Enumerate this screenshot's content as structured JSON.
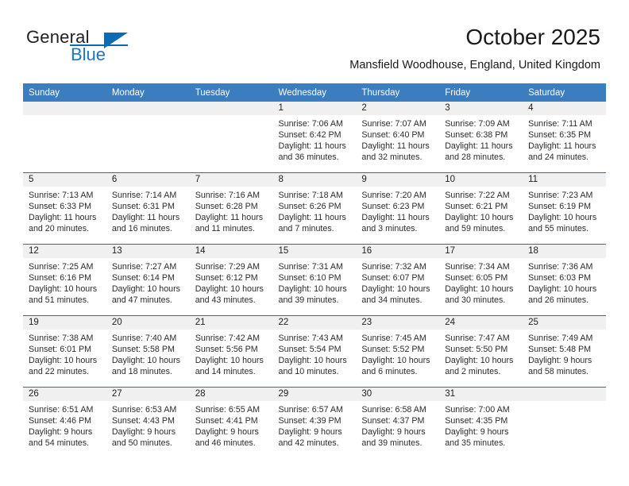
{
  "brand": {
    "name_part1": "General",
    "name_part2": "Blue",
    "logo_icon": "triangle-logo-icon"
  },
  "header": {
    "title": "October 2025",
    "subtitle": "Mansfield Woodhouse, England, United Kingdom"
  },
  "colors": {
    "header_row_bg": "#3b7dbf",
    "day_band_bg": "#f0f0f0",
    "row_divider": "#2e6da4",
    "brand_blue": "#1b77c3",
    "text": "#1a1a1a"
  },
  "weekday_headers": [
    "Sunday",
    "Monday",
    "Tuesday",
    "Wednesday",
    "Thursday",
    "Friday",
    "Saturday"
  ],
  "labels": {
    "sunrise_prefix": "Sunrise:",
    "sunset_prefix": "Sunset:",
    "daylight_prefix": "Daylight:"
  },
  "weeks": [
    [
      {
        "empty": true,
        "day": "",
        "sunrise": "",
        "sunset": "",
        "daylight_l1": "",
        "daylight_l2": ""
      },
      {
        "empty": true,
        "day": "",
        "sunrise": "",
        "sunset": "",
        "daylight_l1": "",
        "daylight_l2": ""
      },
      {
        "empty": true,
        "day": "",
        "sunrise": "",
        "sunset": "",
        "daylight_l1": "",
        "daylight_l2": ""
      },
      {
        "empty": false,
        "day": "1",
        "sunrise": "Sunrise: 7:06 AM",
        "sunset": "Sunset: 6:42 PM",
        "daylight_l1": "Daylight: 11 hours",
        "daylight_l2": "and 36 minutes."
      },
      {
        "empty": false,
        "day": "2",
        "sunrise": "Sunrise: 7:07 AM",
        "sunset": "Sunset: 6:40 PM",
        "daylight_l1": "Daylight: 11 hours",
        "daylight_l2": "and 32 minutes."
      },
      {
        "empty": false,
        "day": "3",
        "sunrise": "Sunrise: 7:09 AM",
        "sunset": "Sunset: 6:38 PM",
        "daylight_l1": "Daylight: 11 hours",
        "daylight_l2": "and 28 minutes."
      },
      {
        "empty": false,
        "day": "4",
        "sunrise": "Sunrise: 7:11 AM",
        "sunset": "Sunset: 6:35 PM",
        "daylight_l1": "Daylight: 11 hours",
        "daylight_l2": "and 24 minutes."
      }
    ],
    [
      {
        "empty": false,
        "day": "5",
        "sunrise": "Sunrise: 7:13 AM",
        "sunset": "Sunset: 6:33 PM",
        "daylight_l1": "Daylight: 11 hours",
        "daylight_l2": "and 20 minutes."
      },
      {
        "empty": false,
        "day": "6",
        "sunrise": "Sunrise: 7:14 AM",
        "sunset": "Sunset: 6:31 PM",
        "daylight_l1": "Daylight: 11 hours",
        "daylight_l2": "and 16 minutes."
      },
      {
        "empty": false,
        "day": "7",
        "sunrise": "Sunrise: 7:16 AM",
        "sunset": "Sunset: 6:28 PM",
        "daylight_l1": "Daylight: 11 hours",
        "daylight_l2": "and 11 minutes."
      },
      {
        "empty": false,
        "day": "8",
        "sunrise": "Sunrise: 7:18 AM",
        "sunset": "Sunset: 6:26 PM",
        "daylight_l1": "Daylight: 11 hours",
        "daylight_l2": "and 7 minutes."
      },
      {
        "empty": false,
        "day": "9",
        "sunrise": "Sunrise: 7:20 AM",
        "sunset": "Sunset: 6:23 PM",
        "daylight_l1": "Daylight: 11 hours",
        "daylight_l2": "and 3 minutes."
      },
      {
        "empty": false,
        "day": "10",
        "sunrise": "Sunrise: 7:22 AM",
        "sunset": "Sunset: 6:21 PM",
        "daylight_l1": "Daylight: 10 hours",
        "daylight_l2": "and 59 minutes."
      },
      {
        "empty": false,
        "day": "11",
        "sunrise": "Sunrise: 7:23 AM",
        "sunset": "Sunset: 6:19 PM",
        "daylight_l1": "Daylight: 10 hours",
        "daylight_l2": "and 55 minutes."
      }
    ],
    [
      {
        "empty": false,
        "day": "12",
        "sunrise": "Sunrise: 7:25 AM",
        "sunset": "Sunset: 6:16 PM",
        "daylight_l1": "Daylight: 10 hours",
        "daylight_l2": "and 51 minutes."
      },
      {
        "empty": false,
        "day": "13",
        "sunrise": "Sunrise: 7:27 AM",
        "sunset": "Sunset: 6:14 PM",
        "daylight_l1": "Daylight: 10 hours",
        "daylight_l2": "and 47 minutes."
      },
      {
        "empty": false,
        "day": "14",
        "sunrise": "Sunrise: 7:29 AM",
        "sunset": "Sunset: 6:12 PM",
        "daylight_l1": "Daylight: 10 hours",
        "daylight_l2": "and 43 minutes."
      },
      {
        "empty": false,
        "day": "15",
        "sunrise": "Sunrise: 7:31 AM",
        "sunset": "Sunset: 6:10 PM",
        "daylight_l1": "Daylight: 10 hours",
        "daylight_l2": "and 39 minutes."
      },
      {
        "empty": false,
        "day": "16",
        "sunrise": "Sunrise: 7:32 AM",
        "sunset": "Sunset: 6:07 PM",
        "daylight_l1": "Daylight: 10 hours",
        "daylight_l2": "and 34 minutes."
      },
      {
        "empty": false,
        "day": "17",
        "sunrise": "Sunrise: 7:34 AM",
        "sunset": "Sunset: 6:05 PM",
        "daylight_l1": "Daylight: 10 hours",
        "daylight_l2": "and 30 minutes."
      },
      {
        "empty": false,
        "day": "18",
        "sunrise": "Sunrise: 7:36 AM",
        "sunset": "Sunset: 6:03 PM",
        "daylight_l1": "Daylight: 10 hours",
        "daylight_l2": "and 26 minutes."
      }
    ],
    [
      {
        "empty": false,
        "day": "19",
        "sunrise": "Sunrise: 7:38 AM",
        "sunset": "Sunset: 6:01 PM",
        "daylight_l1": "Daylight: 10 hours",
        "daylight_l2": "and 22 minutes."
      },
      {
        "empty": false,
        "day": "20",
        "sunrise": "Sunrise: 7:40 AM",
        "sunset": "Sunset: 5:58 PM",
        "daylight_l1": "Daylight: 10 hours",
        "daylight_l2": "and 18 minutes."
      },
      {
        "empty": false,
        "day": "21",
        "sunrise": "Sunrise: 7:42 AM",
        "sunset": "Sunset: 5:56 PM",
        "daylight_l1": "Daylight: 10 hours",
        "daylight_l2": "and 14 minutes."
      },
      {
        "empty": false,
        "day": "22",
        "sunrise": "Sunrise: 7:43 AM",
        "sunset": "Sunset: 5:54 PM",
        "daylight_l1": "Daylight: 10 hours",
        "daylight_l2": "and 10 minutes."
      },
      {
        "empty": false,
        "day": "23",
        "sunrise": "Sunrise: 7:45 AM",
        "sunset": "Sunset: 5:52 PM",
        "daylight_l1": "Daylight: 10 hours",
        "daylight_l2": "and 6 minutes."
      },
      {
        "empty": false,
        "day": "24",
        "sunrise": "Sunrise: 7:47 AM",
        "sunset": "Sunset: 5:50 PM",
        "daylight_l1": "Daylight: 10 hours",
        "daylight_l2": "and 2 minutes."
      },
      {
        "empty": false,
        "day": "25",
        "sunrise": "Sunrise: 7:49 AM",
        "sunset": "Sunset: 5:48 PM",
        "daylight_l1": "Daylight: 9 hours",
        "daylight_l2": "and 58 minutes."
      }
    ],
    [
      {
        "empty": false,
        "day": "26",
        "sunrise": "Sunrise: 6:51 AM",
        "sunset": "Sunset: 4:46 PM",
        "daylight_l1": "Daylight: 9 hours",
        "daylight_l2": "and 54 minutes."
      },
      {
        "empty": false,
        "day": "27",
        "sunrise": "Sunrise: 6:53 AM",
        "sunset": "Sunset: 4:43 PM",
        "daylight_l1": "Daylight: 9 hours",
        "daylight_l2": "and 50 minutes."
      },
      {
        "empty": false,
        "day": "28",
        "sunrise": "Sunrise: 6:55 AM",
        "sunset": "Sunset: 4:41 PM",
        "daylight_l1": "Daylight: 9 hours",
        "daylight_l2": "and 46 minutes."
      },
      {
        "empty": false,
        "day": "29",
        "sunrise": "Sunrise: 6:57 AM",
        "sunset": "Sunset: 4:39 PM",
        "daylight_l1": "Daylight: 9 hours",
        "daylight_l2": "and 42 minutes."
      },
      {
        "empty": false,
        "day": "30",
        "sunrise": "Sunrise: 6:58 AM",
        "sunset": "Sunset: 4:37 PM",
        "daylight_l1": "Daylight: 9 hours",
        "daylight_l2": "and 39 minutes."
      },
      {
        "empty": false,
        "day": "31",
        "sunrise": "Sunrise: 7:00 AM",
        "sunset": "Sunset: 4:35 PM",
        "daylight_l1": "Daylight: 9 hours",
        "daylight_l2": "and 35 minutes."
      },
      {
        "empty": true,
        "day": "",
        "sunrise": "",
        "sunset": "",
        "daylight_l1": "",
        "daylight_l2": ""
      }
    ]
  ]
}
